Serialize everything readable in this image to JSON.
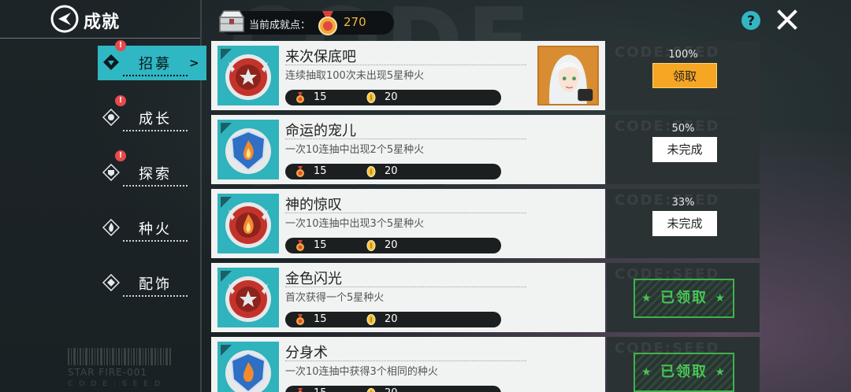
{
  "header": {
    "title": "成就",
    "points_label": "当前成就点：",
    "points_value": "270",
    "bg_watermark": "CODE SEED"
  },
  "sidebar": {
    "tabs": [
      {
        "label": "招募",
        "icon": "recruit-icon",
        "badge": "!",
        "active": true
      },
      {
        "label": "成长",
        "icon": "growth-icon",
        "badge": "!",
        "active": false
      },
      {
        "label": "探索",
        "icon": "explore-icon",
        "badge": "!",
        "active": false
      },
      {
        "label": "种火",
        "icon": "fire-icon",
        "badge": "",
        "active": false
      },
      {
        "label": "配饰",
        "icon": "accessory-icon",
        "badge": "",
        "active": false
      }
    ],
    "barcode_text": "STAR FIRE-001",
    "barcode_sub": "CODE:SEED"
  },
  "panel_watermark": "CODE:SEED",
  "achievements": [
    {
      "title": "来次保底吧",
      "desc": "连续抽取100次未出现5星种火",
      "reward_points": "15",
      "reward_coins": "20",
      "progress": "100%",
      "status": "领取",
      "state": "claimable",
      "emblem": "star",
      "emblem_color": "#c4332b"
    },
    {
      "title": "命运的宠儿",
      "desc": "一次10连抽中出现2个5星种火",
      "reward_points": "15",
      "reward_coins": "20",
      "progress": "50%",
      "status": "未完成",
      "state": "incomplete",
      "emblem": "flame",
      "emblem_color": "#2f6fc4"
    },
    {
      "title": "神的惊叹",
      "desc": "一次10连抽中出现3个5星种火",
      "reward_points": "15",
      "reward_coins": "20",
      "progress": "33%",
      "status": "未完成",
      "state": "incomplete",
      "emblem": "flame",
      "emblem_color": "#c4332b"
    },
    {
      "title": "金色闪光",
      "desc": "首次获得一个5星种火",
      "reward_points": "15",
      "reward_coins": "20",
      "progress": "",
      "status": "已领取",
      "state": "claimed",
      "emblem": "star",
      "emblem_color": "#c4332b"
    },
    {
      "title": "分身术",
      "desc": "一次10连抽中获得3个相同的种火",
      "reward_points": "15",
      "reward_coins": "20",
      "progress": "",
      "status": "已领取",
      "state": "claimed",
      "emblem": "flame",
      "emblem_color": "#2f6fc4"
    }
  ]
}
